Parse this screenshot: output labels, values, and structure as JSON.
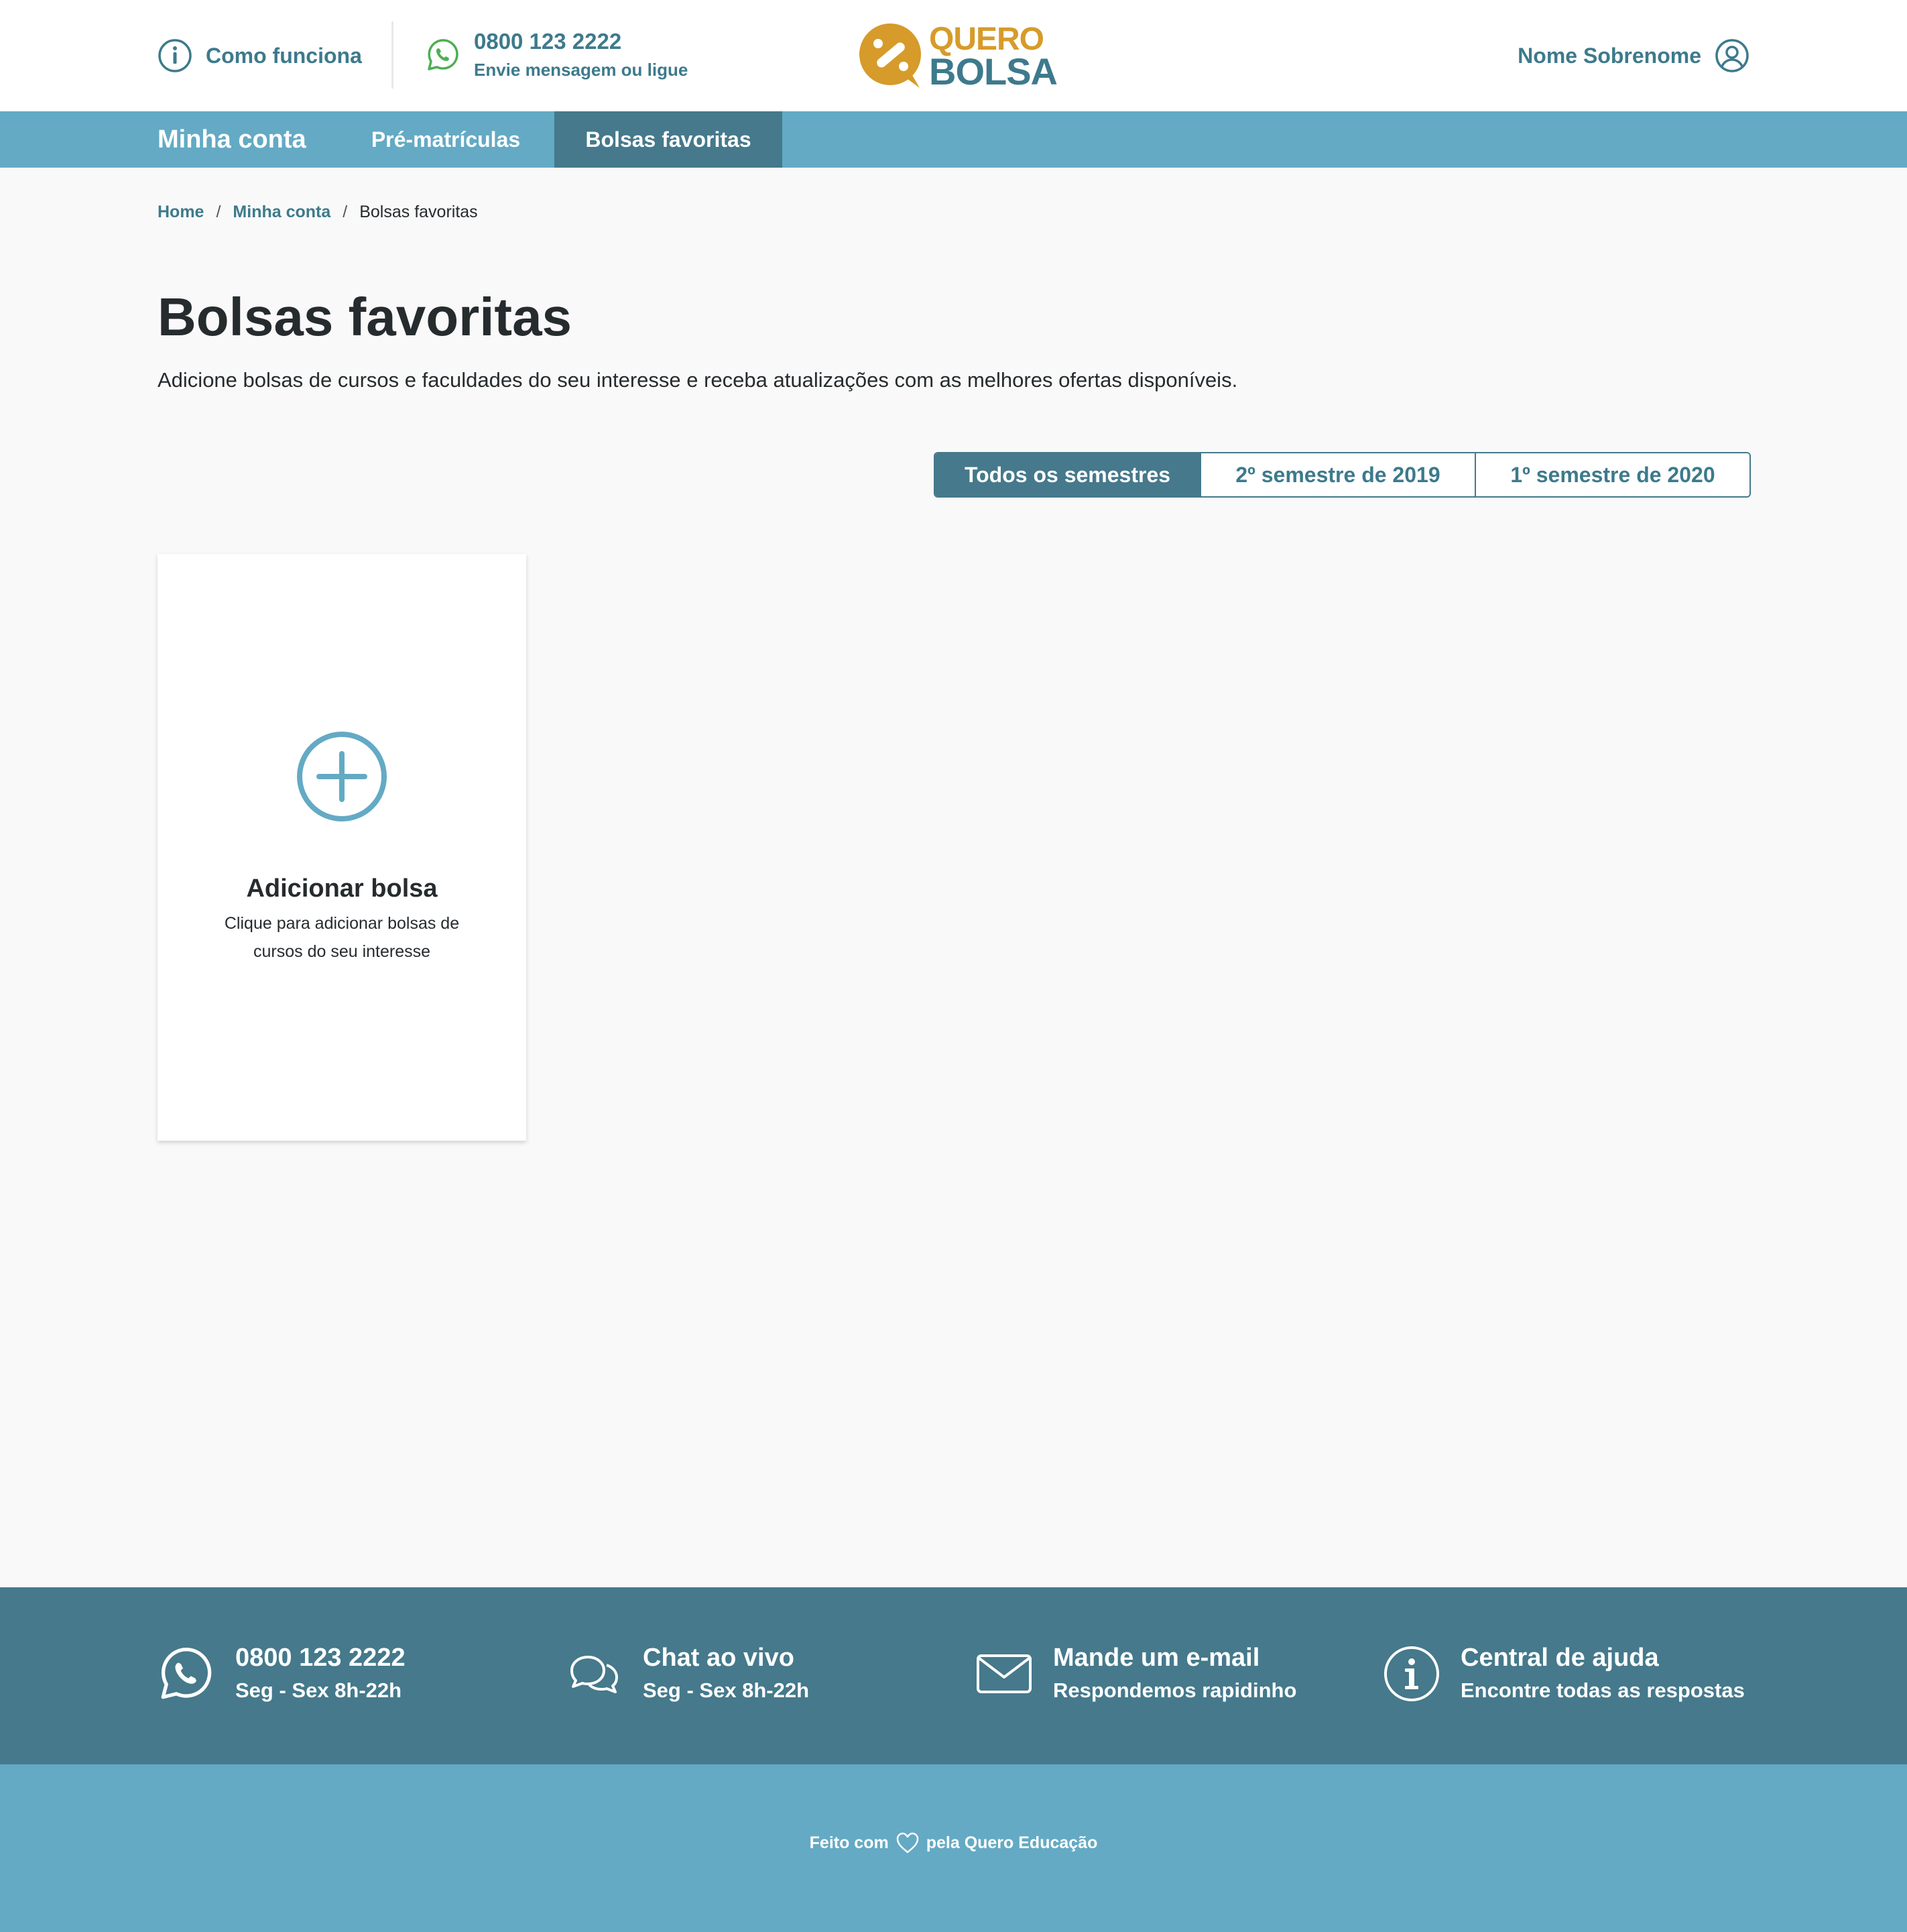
{
  "header": {
    "how_it_works": "Como funciona",
    "phone": "0800 123 2222",
    "phone_sub": "Envie mensagem ou ligue",
    "logo_line1": "QUERO",
    "logo_line2": "BOLSA",
    "user_name": "Nome Sobrenome"
  },
  "nav": {
    "title": "Minha conta",
    "tabs": [
      {
        "label": "Pré-matrículas",
        "active": false
      },
      {
        "label": "Bolsas favoritas",
        "active": true
      }
    ]
  },
  "breadcrumb": {
    "items": [
      "Home",
      "Minha conta",
      "Bolsas favoritas"
    ],
    "separator": "/"
  },
  "page": {
    "title": "Bolsas favoritas",
    "description": "Adicione bolsas de cursos e faculdades do seu interesse e receba atualizações com as melhores ofertas disponíveis."
  },
  "semester_filter": {
    "options": [
      "Todos os semestres",
      "2º semestre de 2019",
      "1º semestre de 2020"
    ],
    "selected": "Todos os semestres"
  },
  "add_card": {
    "title": "Adicionar bolsa",
    "description": "Clique para adicionar bolsas de cursos do seu interesse"
  },
  "footer": {
    "contacts": [
      {
        "icon": "whatsapp-icon",
        "title": "0800 123 2222",
        "subtitle": "Seg - Sex 8h-22h"
      },
      {
        "icon": "chat-icon",
        "title": "Chat ao vivo",
        "subtitle": "Seg - Sex 8h-22h"
      },
      {
        "icon": "mail-icon",
        "title": "Mande um e-mail",
        "subtitle": "Respondemos rapidinho"
      },
      {
        "icon": "info-icon",
        "title": "Central de ajuda",
        "subtitle": "Encontre todas as respostas"
      }
    ],
    "made_with_prefix": "Feito com",
    "made_with_suffix": "pela Quero Educação"
  },
  "colors": {
    "primary": "#3d7a8c",
    "primary_dark": "#45798b",
    "primary_light": "#64aac4",
    "brand_yellow": "#d69b2a",
    "whatsapp_green": "#4caf50",
    "background": "#f9f9f9",
    "text": "#262b2e"
  }
}
